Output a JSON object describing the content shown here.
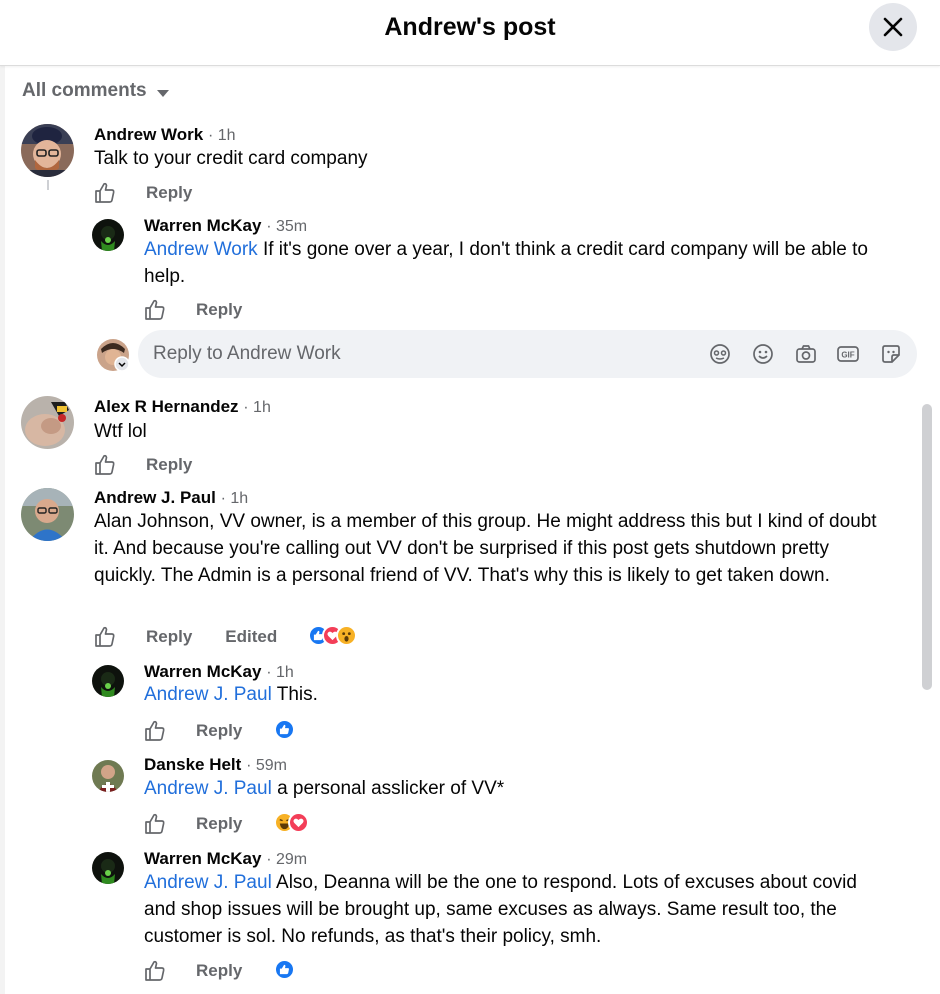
{
  "header": {
    "title": "Andrew's post"
  },
  "sort": {
    "label": "All comments"
  },
  "composer": {
    "placeholder": "Reply to Andrew Work"
  },
  "comments": [
    {
      "author": "Andrew Work",
      "time": "· 1h",
      "text": "Talk to your credit card company",
      "reply": "Reply"
    },
    {
      "author": "Warren McKay",
      "time": "· 35m",
      "mention": "Andrew Work",
      "text": " If it's gone over a year, I don't think a credit card company will be able to help.",
      "reply": "Reply"
    },
    {
      "author": "Alex R Hernandez",
      "time": "· 1h",
      "text": "Wtf lol",
      "reply": "Reply"
    },
    {
      "author": "Andrew J. Paul",
      "time": "· 1h",
      "text": "Alan Johnson, VV owner, is a member of this group. He might address this but I kind of doubt it. And because you're calling out VV don't be surprised if this post gets shutdown pretty quickly. The Admin is a personal friend of VV. That's why this is likely to get taken down.",
      "reply": "Reply",
      "edited": "Edited",
      "reactions": [
        "like",
        "love",
        "wow"
      ]
    },
    {
      "author": "Warren McKay",
      "time": "· 1h",
      "mention": "Andrew J. Paul",
      "text": " This.",
      "reply": "Reply",
      "reactions": [
        "like"
      ]
    },
    {
      "author": "Danske Helt",
      "time": "· 59m",
      "mention": "Andrew J. Paul",
      "text": " a personal asslicker of VV*",
      "reply": "Reply",
      "reactions": [
        "haha",
        "love"
      ]
    },
    {
      "author": "Warren McKay",
      "time": "· 29m",
      "mention": "Andrew J. Paul",
      "text": " Also, Deanna will be the one to respond. Lots of excuses about covid and shop issues will be brought up, same excuses as always. Same result too, the customer is sol. No refunds, as that's their policy, smh.",
      "reply": "Reply",
      "reactions": [
        "like"
      ]
    }
  ],
  "colors": {
    "mention": "#216fdb",
    "secondary": "#65676b",
    "like": "#1877f2",
    "love": "#f33e58",
    "haha": "#f7b125"
  },
  "icons": [
    "close-icon",
    "caret-down-icon",
    "thumbs-up-icon",
    "avatar-sticker-icon",
    "emoji-icon",
    "camera-icon",
    "gif-icon",
    "sticker-icon"
  ]
}
